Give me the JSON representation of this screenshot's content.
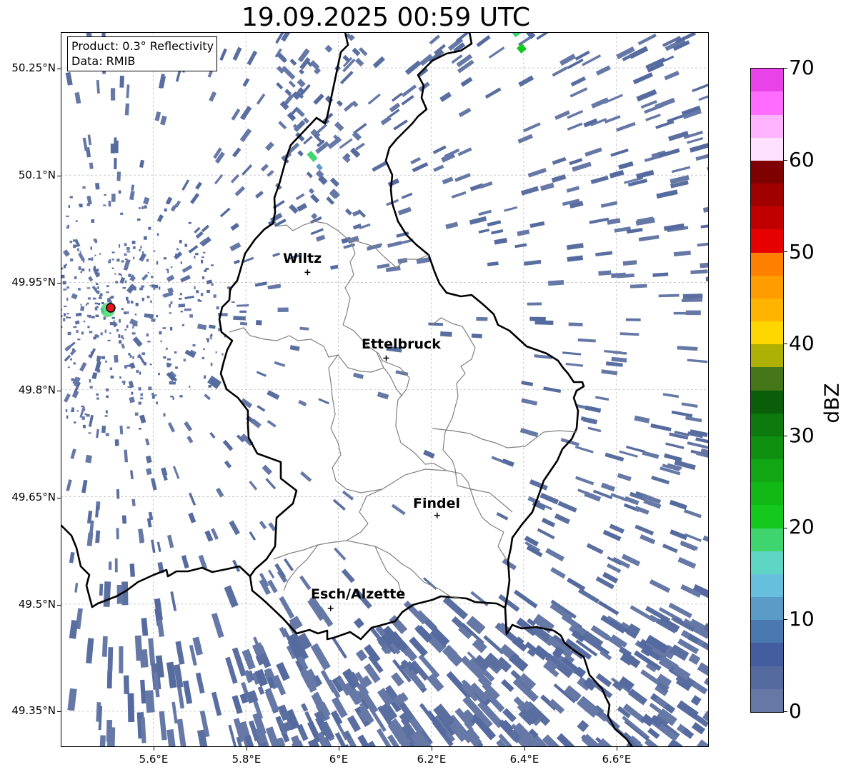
{
  "title": "19.09.2025 00:59 UTC",
  "info": {
    "product": "Product: 0.3° Reflectivity",
    "data": "Data: RMIB"
  },
  "map": {
    "lon_range": [
      5.4,
      6.8
    ],
    "lat_range": [
      49.3,
      50.3
    ],
    "lat_ticks": [
      "50.25°N",
      "50.1°N",
      "49.95°N",
      "49.8°N",
      "49.65°N",
      "49.5°N",
      "49.35°N"
    ],
    "lon_ticks": [
      "5.6°E",
      "5.8°E",
      "6°E",
      "6.2°E",
      "6.4°E",
      "6.6°E"
    ],
    "grid": true,
    "radar_site": {
      "lon": 5.505,
      "lat": 49.914,
      "color": "#e8141c"
    },
    "cities": [
      {
        "name": "Wiltz",
        "lon": 5.93,
        "lat": 49.97
      },
      {
        "name": "Ettelbruck",
        "lon": 6.1,
        "lat": 49.85
      },
      {
        "name": "Findel",
        "lon": 6.21,
        "lat": 49.63
      },
      {
        "name": "Esch/Alzette",
        "lon": 5.98,
        "lat": 49.5
      }
    ]
  },
  "colorbar": {
    "label": "dBZ",
    "min": 0,
    "max": 70,
    "step_dbz": 2.5,
    "tick_labels": [
      "0",
      "10",
      "20",
      "30",
      "40",
      "50",
      "60",
      "70"
    ],
    "colors": [
      "#6678a6",
      "#556a9e",
      "#435d9f",
      "#4a78b0",
      "#5a9cc7",
      "#66c0dd",
      "#5ed4c4",
      "#3ed46e",
      "#14c81e",
      "#12b816",
      "#13a614",
      "#0f8f10",
      "#0c7a0d",
      "#0a5e0a",
      "#46761a",
      "#aeb004",
      "#ffd700",
      "#ffb500",
      "#ff9c00",
      "#ff7f00",
      "#e60000",
      "#c00000",
      "#a00000",
      "#7f0000",
      "#ffe0ff",
      "#ffb4ff",
      "#ff6cff",
      "#e842e8"
    ]
  }
}
